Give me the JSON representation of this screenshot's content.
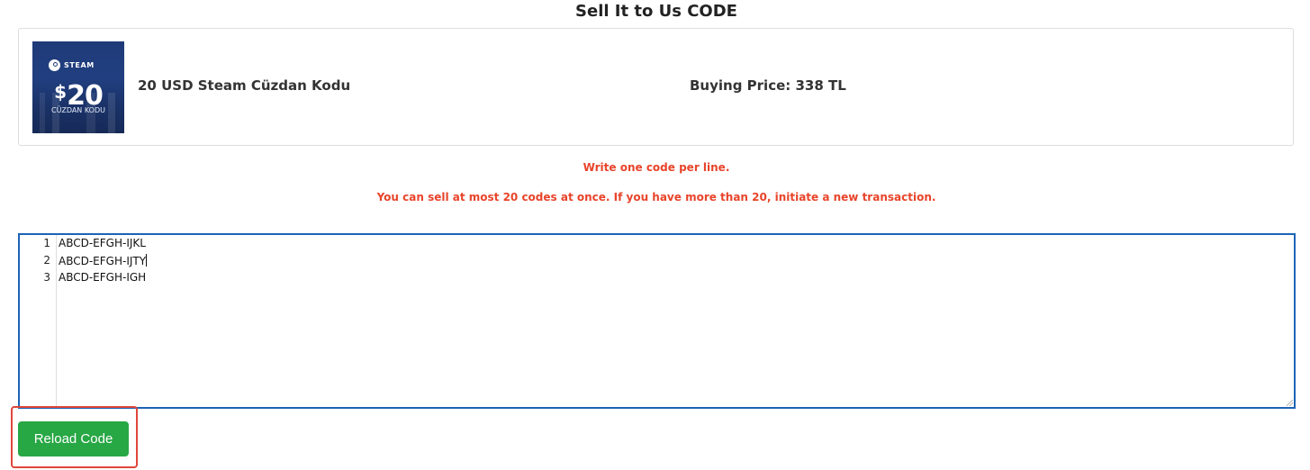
{
  "page": {
    "title": "Sell It to Us CODE"
  },
  "product": {
    "image": {
      "brand": "STEAM",
      "amount": "20",
      "currency_symbol": "$",
      "caption": "CÜZDAN KODU",
      "icon": "steam-logo-icon",
      "background_color": "#1f3a78"
    },
    "name": "20 USD Steam Cüzdan Kodu",
    "buying_price": "Buying Price: 338 TL"
  },
  "notices": {
    "per_line": "Write one code per line.",
    "limit": "You can sell at most 20 codes at once. If you have more than 20, initiate a new transaction.",
    "color": "#e8442a"
  },
  "editor": {
    "lines": [
      {
        "number": "1",
        "code": "ABCD-EFGH-IJKL"
      },
      {
        "number": "2",
        "code": "ABCD-EFGH-IJTY"
      },
      {
        "number": "3",
        "code": "ABCD-EFGH-IGH"
      }
    ],
    "border_color": "#1b63b5"
  },
  "actions": {
    "reload_label": "Reload Code",
    "button_color": "#28a745",
    "highlight_color": "#e0463a"
  }
}
